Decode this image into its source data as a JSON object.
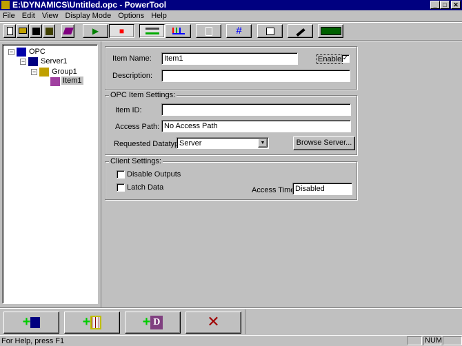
{
  "window": {
    "title": "E:\\DYNAMICS\\Untitled.opc - PowerTool",
    "minimize": "_",
    "maximize": "□",
    "close": "✕"
  },
  "menu": [
    "File",
    "Edit",
    "View",
    "Display Mode",
    "Options",
    "Help"
  ],
  "toolbar": {
    "run": "▶",
    "stop": "■"
  },
  "tree": {
    "root": "OPC",
    "server": "Server1",
    "group": "Group1",
    "item": "Item1",
    "expanded": "−"
  },
  "form": {
    "item_name_label": "Item Name:",
    "item_name": "Item1",
    "enable_label": "Enable",
    "enable_checked": "✓",
    "description_label": "Description:",
    "description": "",
    "opc_settings_legend": "OPC Item Settings:",
    "item_id_label": "Item ID:",
    "item_id": "",
    "access_path_label": "Access Path:",
    "access_path": "No Access Path",
    "datatype_label": "Requested Datatype:",
    "datatype": "Server",
    "dropdown_arrow": "▼",
    "browse_label": "Browse Server...",
    "client_settings_legend": "Client Settings:",
    "disable_outputs_label": "Disable Outputs",
    "latch_data_label": "Latch Data",
    "access_time_label": "Access Time:",
    "access_time": "Disabled"
  },
  "bottom": {
    "plus": "+",
    "delete": "✕",
    "block_letter": "D"
  },
  "status": {
    "help": "For Help, press F1",
    "num": "NUM"
  }
}
